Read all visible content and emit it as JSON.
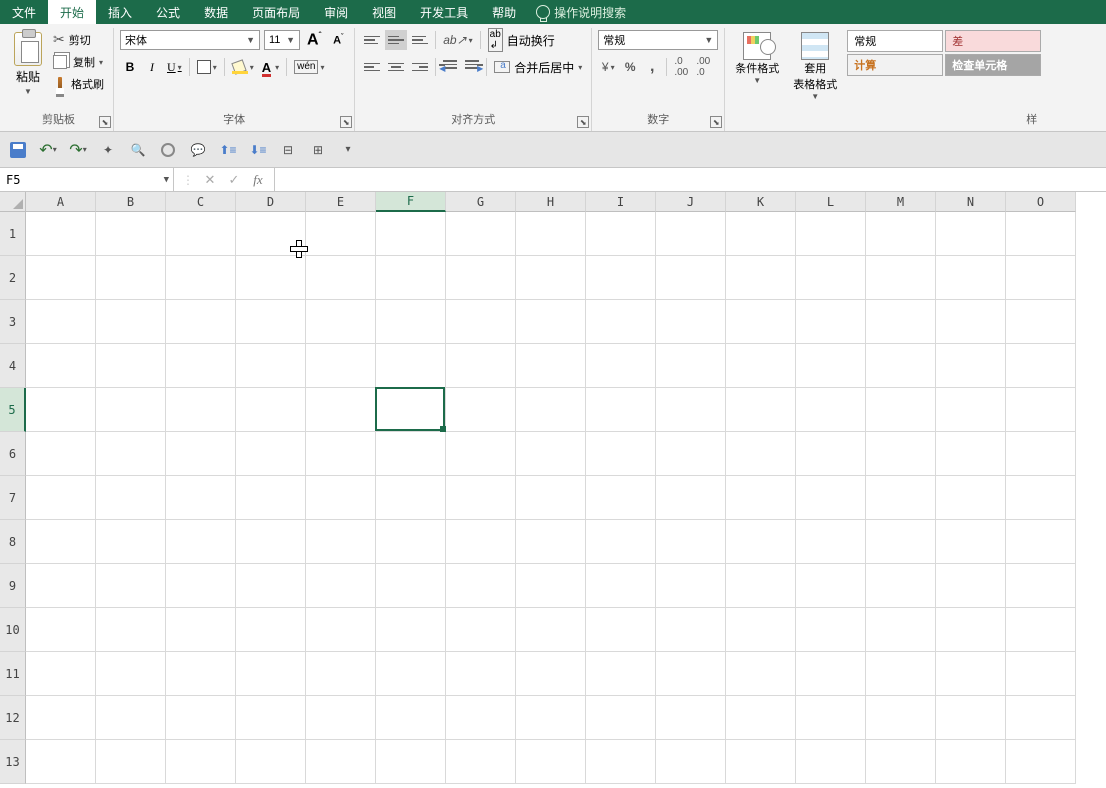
{
  "menubar": {
    "items": [
      "文件",
      "开始",
      "插入",
      "公式",
      "数据",
      "页面布局",
      "审阅",
      "视图",
      "开发工具",
      "帮助"
    ],
    "active_index": 1,
    "search_placeholder": "操作说明搜索"
  },
  "ribbon": {
    "clipboard": {
      "paste": "粘贴",
      "cut": "剪切",
      "copy": "复制",
      "format_painter": "格式刷",
      "group_label": "剪贴板"
    },
    "font": {
      "font_name": "宋体",
      "font_size": "11",
      "bold": "B",
      "italic": "I",
      "underline": "U",
      "phonetic": "wén",
      "group_label": "字体"
    },
    "alignment": {
      "wrap_text": "自动换行",
      "merge_center": "合并后居中",
      "group_label": "对齐方式"
    },
    "number": {
      "format": "常规",
      "group_label": "数字"
    },
    "styles": {
      "conditional": "条件格式",
      "table_format": "套用\n表格格式",
      "cell_normal": "常规",
      "cell_bad": "差",
      "cell_calc": "计算",
      "cell_check": "检查单元格",
      "group_label": "样"
    }
  },
  "name_box": "F5",
  "fx_label": "fx",
  "columns": [
    "A",
    "B",
    "C",
    "D",
    "E",
    "F",
    "G",
    "H",
    "I",
    "J",
    "K",
    "L",
    "M",
    "N",
    "O"
  ],
  "rows": [
    "1",
    "2",
    "3",
    "4",
    "5",
    "6",
    "7",
    "8",
    "9",
    "10",
    "11",
    "12",
    "13"
  ],
  "active_col_index": 5,
  "active_row_index": 4
}
